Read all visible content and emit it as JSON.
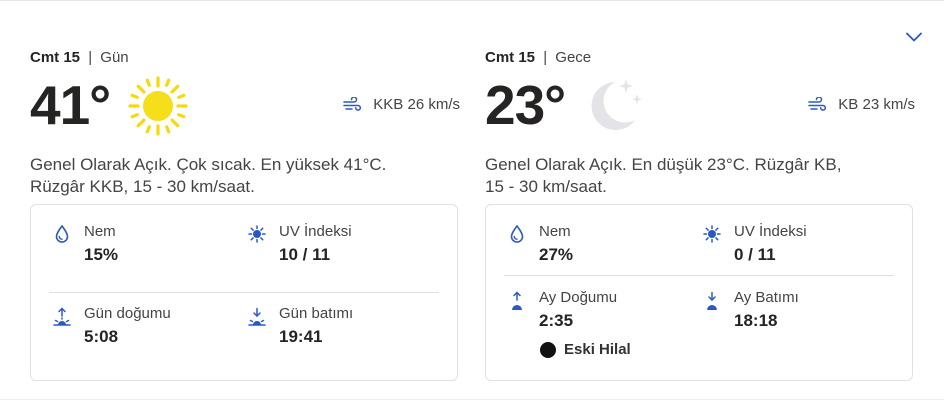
{
  "day": {
    "day_name": "Cmt 15",
    "separator": "|",
    "period": "Gün",
    "temperature": "41°",
    "condition_icon": "sun-icon",
    "wind": "KKB 26 km/s",
    "summary_line1": "Genel Olarak Açık. Çok sıcak. En yüksek 41°C.",
    "summary_line2": "Rüzgâr KKB, 15 - 30 km/saat.",
    "humidity_label": "Nem",
    "humidity_value": "15%",
    "uv_label": "UV İndeksi",
    "uv_value": "10 / 11",
    "sunrise_label": "Gün doğumu",
    "sunrise_value": "5:08",
    "sunset_label": "Gün batımı",
    "sunset_value": "19:41"
  },
  "night": {
    "day_name": "Cmt 15",
    "separator": "|",
    "period": "Gece",
    "temperature": "23°",
    "condition_icon": "moon-icon",
    "wind": "KB 23 km/s",
    "summary_line1": "Genel Olarak Açık. En düşük 23°C. Rüzgâr KB,",
    "summary_line2": "15 - 30 km/saat.",
    "humidity_label": "Nem",
    "humidity_value": "27%",
    "uv_label": "UV İndeksi",
    "uv_value": "0 / 11",
    "moonrise_label": "Ay Doğumu",
    "moonrise_value": "2:35",
    "moonset_label": "Ay Batımı",
    "moonset_value": "18:18",
    "moon_phase": "Eski Hilal"
  },
  "colors": {
    "accent": "#2b59c3",
    "sun": "#f5d90a",
    "moon": "#e4e4e8",
    "text": "#252423",
    "muted": "#444444"
  }
}
